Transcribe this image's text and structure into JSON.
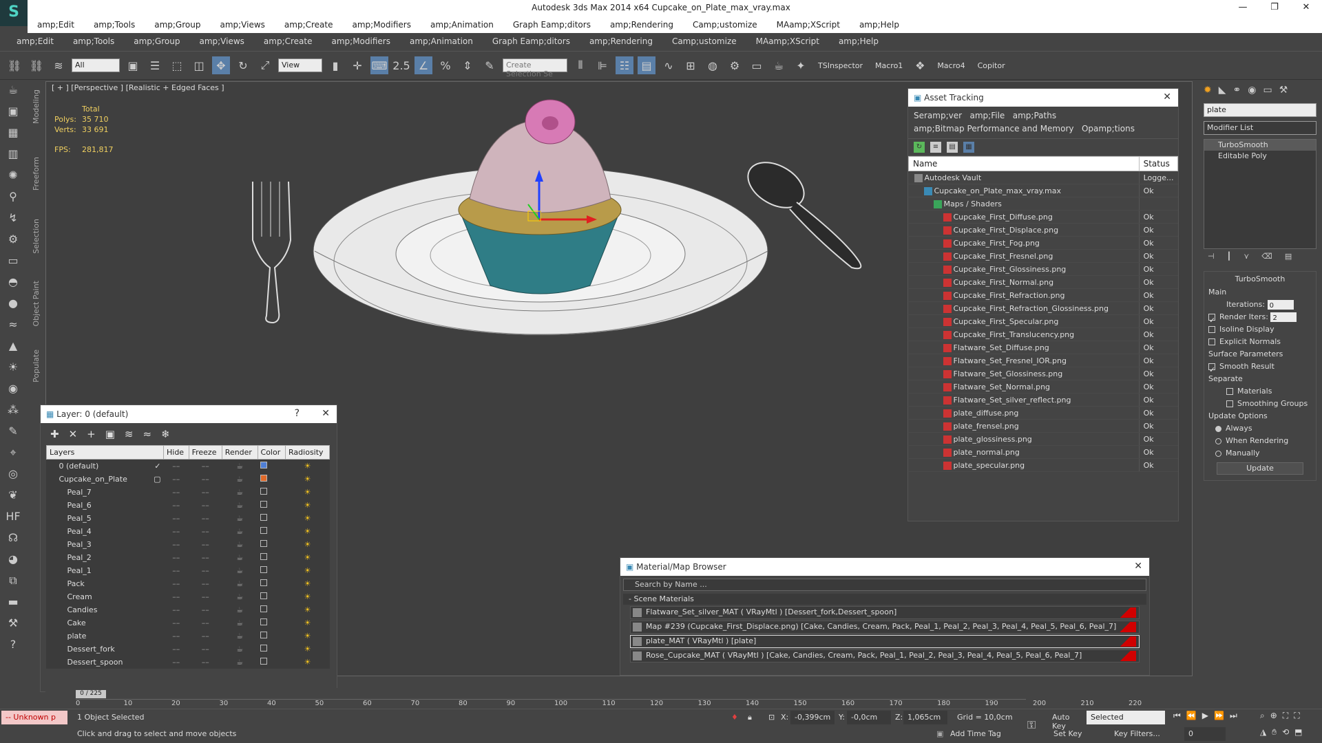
{
  "app": {
    "title": "Autodesk 3ds Max  2014 x64      Cupcake_on_Plate_max_vray.max",
    "logo_glyph": "S",
    "window_buttons": [
      "—",
      "❐",
      "✕"
    ]
  },
  "menu_primary": [
    "amp;Edit",
    "amp;Tools",
    "amp;Group",
    "amp;Views",
    "amp;Create",
    "amp;Modifiers",
    "amp;Animation",
    "Graph Eamp;ditors",
    "amp;Rendering",
    "Camp;ustomize",
    "MAamp;XScript",
    "amp;Help"
  ],
  "menu_secondary": [
    "amp;Edit",
    "amp;Tools",
    "amp;Group",
    "amp;Views",
    "amp;Create",
    "amp;Modifiers",
    "amp;Animation",
    "Graph Eamp;ditors",
    "amp;Rendering",
    "Camp;ustomize",
    "MAamp;XScript",
    "amp;Help"
  ],
  "toolbar": {
    "filter_value": "All",
    "view_value": "View",
    "selection_set_placeholder": "Create Selection Se",
    "snap_label": "2.5",
    "tsinspector_label": "TSInspector",
    "macro1_label": "Macro1",
    "macro4_label": "Macro4",
    "copitor_label": "Copitor"
  },
  "side_tabs": [
    "Modeling",
    "Freeform",
    "Selection",
    "Object Paint",
    "Populate"
  ],
  "viewport": {
    "label": "[ + ] [Perspective ] [Realistic + Edged Faces ]",
    "stats_total_label": "Total",
    "polys_label": "Polys:",
    "polys_value": "35 710",
    "verts_label": "Verts:",
    "verts_value": "33 691",
    "fps_label": "FPS:",
    "fps_value": "281,817"
  },
  "asset_tracking": {
    "title": "Asset Tracking",
    "menu": [
      "Seramp;ver",
      "amp;File",
      "amp;Paths",
      "amp;Bitmap Performance and Memory",
      "Opamp;tions"
    ],
    "col_name": "Name",
    "col_status": "Status",
    "rows": [
      {
        "name": "Autodesk Vault",
        "status": "Logge...",
        "indent": 0
      },
      {
        "name": "Cupcake_on_Plate_max_vray.max",
        "status": "Ok",
        "indent": 1
      },
      {
        "name": "Maps / Shaders",
        "status": "",
        "indent": 2
      },
      {
        "name": "Cupcake_First_Diffuse.png",
        "status": "Ok",
        "indent": 3
      },
      {
        "name": "Cupcake_First_Displace.png",
        "status": "Ok",
        "indent": 3
      },
      {
        "name": "Cupcake_First_Fog.png",
        "status": "Ok",
        "indent": 3
      },
      {
        "name": "Cupcake_First_Fresnel.png",
        "status": "Ok",
        "indent": 3
      },
      {
        "name": "Cupcake_First_Glossiness.png",
        "status": "Ok",
        "indent": 3
      },
      {
        "name": "Cupcake_First_Normal.png",
        "status": "Ok",
        "indent": 3
      },
      {
        "name": "Cupcake_First_Refraction.png",
        "status": "Ok",
        "indent": 3
      },
      {
        "name": "Cupcake_First_Refraction_Glossiness.png",
        "status": "Ok",
        "indent": 3
      },
      {
        "name": "Cupcake_First_Specular.png",
        "status": "Ok",
        "indent": 3
      },
      {
        "name": "Cupcake_First_Translucency.png",
        "status": "Ok",
        "indent": 3
      },
      {
        "name": "Flatware_Set_Diffuse.png",
        "status": "Ok",
        "indent": 3
      },
      {
        "name": "Flatware_Set_Fresnel_IOR.png",
        "status": "Ok",
        "indent": 3
      },
      {
        "name": "Flatware_Set_Glossiness.png",
        "status": "Ok",
        "indent": 3
      },
      {
        "name": "Flatware_Set_Normal.png",
        "status": "Ok",
        "indent": 3
      },
      {
        "name": "Flatware_Set_silver_reflect.png",
        "status": "Ok",
        "indent": 3
      },
      {
        "name": "plate_diffuse.png",
        "status": "Ok",
        "indent": 3
      },
      {
        "name": "plate_frensel.png",
        "status": "Ok",
        "indent": 3
      },
      {
        "name": "plate_glossiness.png",
        "status": "Ok",
        "indent": 3
      },
      {
        "name": "plate_normal.png",
        "status": "Ok",
        "indent": 3
      },
      {
        "name": "plate_specular.png",
        "status": "Ok",
        "indent": 3
      }
    ]
  },
  "layer_manager": {
    "title": "Layer: 0 (default)",
    "help": "?",
    "columns": [
      "Layers",
      "Hide",
      "Freeze",
      "Render",
      "Color",
      "Radiosity"
    ],
    "rows": [
      {
        "name": "0 (default)",
        "indent": 1,
        "color": "#4f7fd6",
        "check": "✓"
      },
      {
        "name": "Cupcake_on_Plate",
        "indent": 1,
        "color": "#e06a2a",
        "check": "▢"
      },
      {
        "name": "Peal_7",
        "indent": 2,
        "color": "",
        "check": ""
      },
      {
        "name": "Peal_6",
        "indent": 2,
        "color": "",
        "check": ""
      },
      {
        "name": "Peal_5",
        "indent": 2,
        "color": "",
        "check": ""
      },
      {
        "name": "Peal_4",
        "indent": 2,
        "color": "",
        "check": ""
      },
      {
        "name": "Peal_3",
        "indent": 2,
        "color": "",
        "check": ""
      },
      {
        "name": "Peal_2",
        "indent": 2,
        "color": "",
        "check": ""
      },
      {
        "name": "Peal_1",
        "indent": 2,
        "color": "",
        "check": ""
      },
      {
        "name": "Pack",
        "indent": 2,
        "color": "",
        "check": ""
      },
      {
        "name": "Cream",
        "indent": 2,
        "color": "",
        "check": ""
      },
      {
        "name": "Candies",
        "indent": 2,
        "color": "",
        "check": ""
      },
      {
        "name": "Cake",
        "indent": 2,
        "color": "",
        "check": ""
      },
      {
        "name": "plate",
        "indent": 2,
        "color": "",
        "check": ""
      },
      {
        "name": "Dessert_fork",
        "indent": 2,
        "color": "",
        "check": ""
      },
      {
        "name": "Dessert_spoon",
        "indent": 2,
        "color": "",
        "check": ""
      }
    ]
  },
  "material_browser": {
    "title": "Material/Map Browser",
    "search_placeholder": "Search by Name ...",
    "section": "- Scene Materials",
    "items": [
      "Flatware_Set_silver_MAT ( VRayMtl ) [Dessert_fork,Dessert_spoon]",
      "Map #239 (Cupcake_First_Displace.png) [Cake, Candies, Cream, Pack, Peal_1, Peal_2, Peal_3, Peal_4, Peal_5, Peal_6, Peal_7]",
      "plate_MAT ( VRayMtl ) [plate]",
      "Rose_Cupcake_MAT ( VRayMtl ) [Cake, Candies, Cream, Pack, Peal_1, Peal_2, Peal_3, Peal_4, Peal_5, Peal_6, Peal_7]"
    ]
  },
  "command_panel": {
    "object_name": "plate",
    "modifier_list": "Modifier List",
    "stack": [
      "TurboSmooth",
      "Editable Poly"
    ],
    "rollout_title": "TurboSmooth",
    "main_label": "Main",
    "iterations_label": "Iterations:",
    "iterations_value": "0",
    "render_iters_label": "Render Iters:",
    "render_iters_value": "2",
    "isoline_label": "Isoline Display",
    "explicit_normals_label": "Explicit Normals",
    "surface_params_label": "Surface Parameters",
    "smooth_result_label": "Smooth Result",
    "separate_label": "Separate",
    "materials_label": "Materials",
    "smoothing_groups_label": "Smoothing Groups",
    "update_options_label": "Update Options",
    "always_label": "Always",
    "when_rendering_label": "When Rendering",
    "manually_label": "Manually",
    "update_button": "Update"
  },
  "timeline": {
    "frame_display": "0 / 225",
    "ticks": [
      "0",
      "10",
      "20",
      "30",
      "40",
      "50",
      "60",
      "70",
      "80",
      "90",
      "100",
      "110",
      "120",
      "130",
      "140",
      "150",
      "160",
      "170",
      "180",
      "190",
      "200",
      "210",
      "220"
    ]
  },
  "status_bar": {
    "maxscript_text": "-- Unknown p",
    "selection_text": "1 Object Selected",
    "prompt_text": "Click and drag to select and move objects",
    "x_label": "X:",
    "x_value": "-0,399cm",
    "y_label": "Y:",
    "y_value": "-0,0cm",
    "z_label": "Z:",
    "z_value": "1,065cm",
    "grid_text": "Grid = 10,0cm",
    "add_time_tag": "Add Time Tag",
    "auto_key": "Auto Key",
    "set_key": "Set Key",
    "selected_value": "Selected",
    "key_filters": "Key Filters...",
    "frame_value": "0"
  }
}
